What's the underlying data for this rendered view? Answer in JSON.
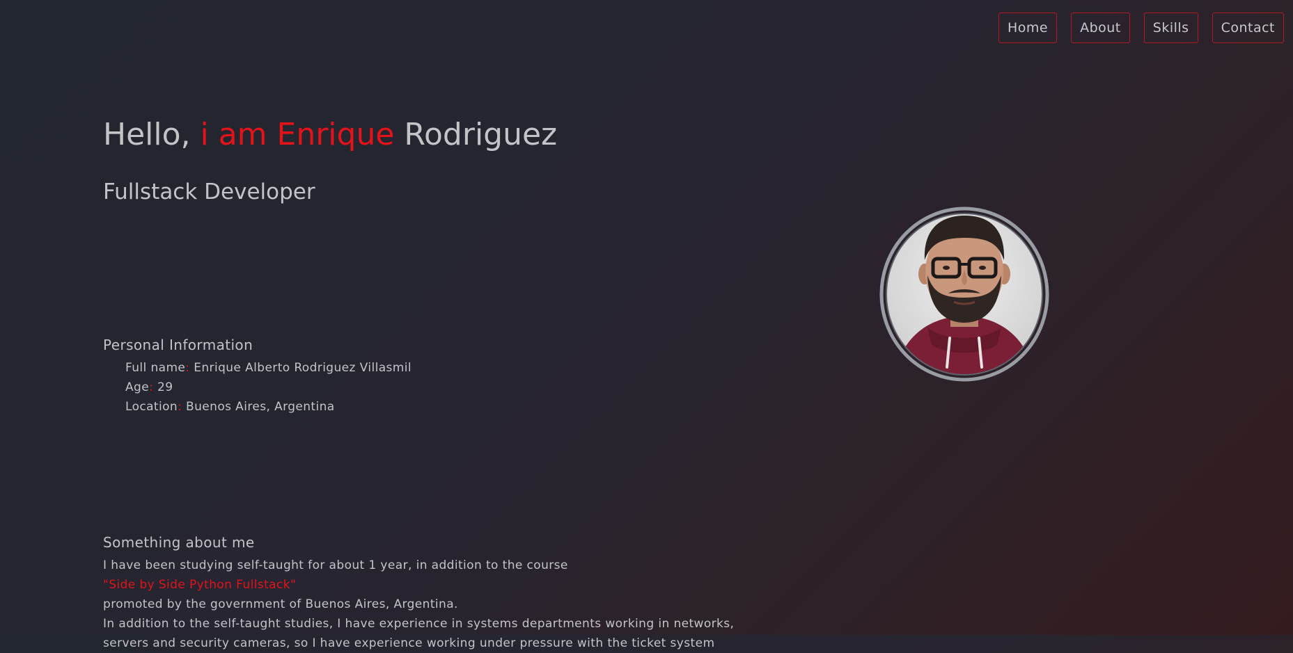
{
  "nav": {
    "items": [
      {
        "label": "Home"
      },
      {
        "label": "About"
      },
      {
        "label": "Skills"
      },
      {
        "label": "Contact"
      }
    ]
  },
  "hero": {
    "greeting": "Hello, ",
    "accent": "i am Enrique",
    "surname": " Rodriguez",
    "subtitle": "Fullstack Developer"
  },
  "personal": {
    "title": "Personal Information",
    "items": [
      {
        "label": "Full name",
        "value": " Enrique Alberto Rodriguez Villasmil"
      },
      {
        "label": "Age",
        "value": " 29"
      },
      {
        "label": "Location",
        "value": " Buenos Aires, Argentina"
      }
    ],
    "separator": ":"
  },
  "about": {
    "title": "Something about me",
    "line1_before": "I have been studying self-taught for about 1 year, in addition to the course ",
    "course": "\"Side by Side Python Fullstack\"",
    "line2": "promoted by the government of Buenos Aires, Argentina.",
    "line3": "In addition to the self-taught studies, I have experience in systems departments working in networks,",
    "line4": "servers and security cameras, so I have experience working under pressure with the ticket system"
  },
  "profile": {
    "photo_icon": "profile-photo",
    "accent_color": "#e3131a"
  }
}
